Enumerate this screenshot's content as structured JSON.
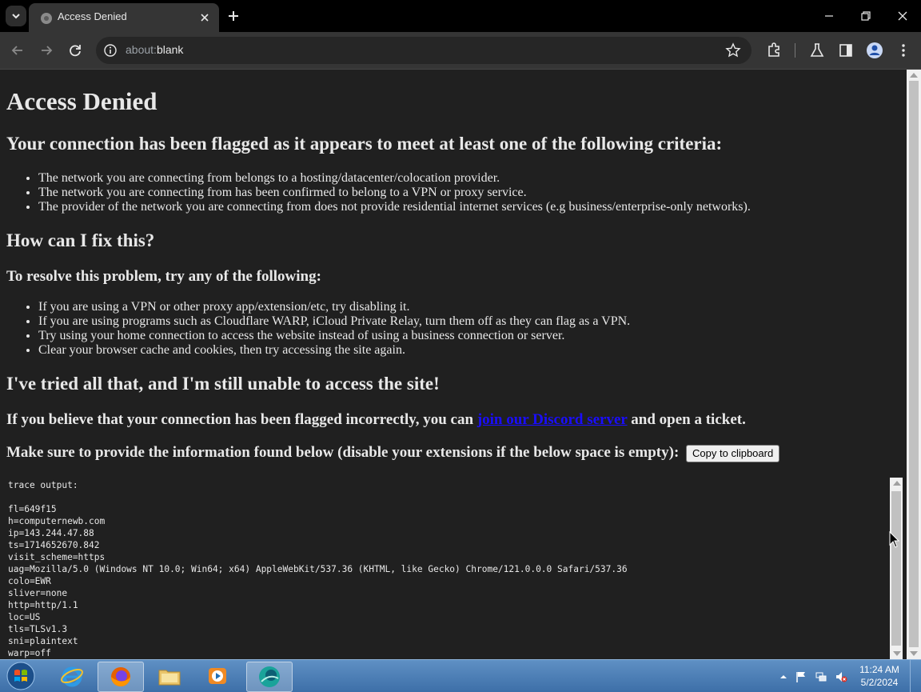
{
  "browser": {
    "tab_title": "Access Denied",
    "url_prefix": "about:",
    "url_rest": "blank"
  },
  "page": {
    "title": "Access Denied",
    "flagged_heading": "Your connection has been flagged as it appears to meet at least one of the following criteria:",
    "criteria": [
      "The network you are connecting from belongs to a hosting/datacenter/colocation provider.",
      "The network you are connecting from has been confirmed to belong to a VPN or proxy service.",
      "The provider of the network you are connecting from does not provide residential internet services (e.g business/enterprise-only networks)."
    ],
    "fix_heading": "How can I fix this?",
    "resolve_heading": "To resolve this problem, try any of the following:",
    "fixes": [
      "If you are using a VPN or other proxy app/extension/etc, try disabling it.",
      "If you are using programs such as Cloudflare WARP, iCloud Private Relay, turn them off as they can flag as a VPN.",
      "Try using your home connection to access the website instead of using a business connection or server.",
      "Clear your browser cache and cookies, then try accessing the site again."
    ],
    "still_heading": "I've tried all that, and I'm still unable to access the site!",
    "incorrect_prefix": "If you believe that your connection has been flagged incorrectly, you can",
    "incorrect_link": "join our Discord server",
    "incorrect_suffix": "and open a ticket.",
    "provide_text": "Make sure to provide the information found below (disable your extensions if the below space is empty):",
    "copy_button": "Copy to clipboard",
    "trace_lines": [
      "trace output:",
      "",
      "fl=649f15",
      "h=computernewb.com",
      "ip=143.244.47.88",
      "ts=1714652670.842",
      "visit_scheme=https",
      "uag=Mozilla/5.0 (Windows NT 10.0; Win64; x64) AppleWebKit/537.36 (KHTML, like Gecko) Chrome/121.0.0.0 Safari/537.36",
      "colo=EWR",
      "sliver=none",
      "http=http/1.1",
      "loc=US",
      "tls=TLSv1.3",
      "sni=plaintext",
      "warp=off"
    ]
  },
  "taskbar": {
    "time": "11:24 AM",
    "date": "5/2/2024"
  },
  "colors": {
    "page_bg": "#202020",
    "link": "#1a0dff",
    "taskbar": "#4a7cb5"
  }
}
